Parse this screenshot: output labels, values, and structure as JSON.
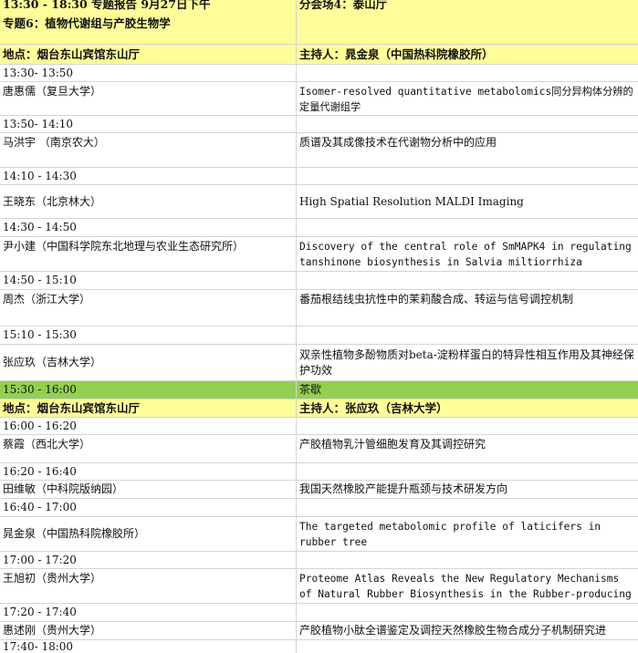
{
  "header": {
    "line1_left": "13:30 - 18:30 专题报告 9月27日下午",
    "line2_left": "专题6：植物代谢组与产胶生物学",
    "right": "分会场4：泰山厅"
  },
  "session1": {
    "location": "地点：烟台东山宾馆东山厅",
    "host": "主持人：晁金泉（中国热科院橡胶所）"
  },
  "break_row": {
    "time": "15:30 - 16:00",
    "label": "茶歇"
  },
  "session2": {
    "location": "地点：烟台东山宾馆东山厅",
    "host": "主持人：张应玖（吉林大学）"
  },
  "talks1": [
    {
      "time": "13:30- 13:50",
      "speaker": "唐惠儒（复旦大学）",
      "title": "Isomer-resolved quantitative metabolomics同分异构体分辨的定量代谢组学"
    },
    {
      "time": "13:50- 14:10",
      "speaker": "马洪宇 （南京农大）",
      "title": "质谱及其成像技术在代谢物分析中的应用"
    },
    {
      "time": "14:10 - 14:30",
      "speaker": "王晓东（北京林大）",
      "title": "High Spatial Resolution MALDI Imaging"
    },
    {
      "time": "14:30 - 14:50",
      "speaker": "尹小建（中国科学院东北地理与农业生态研究所）",
      "title": "Discovery of the central role of SmMAPK4 in regulating tanshinone biosynthesis in Salvia miltiorrhiza"
    },
    {
      "time": "14:50 - 15:10",
      "speaker": "周杰（浙江大学）",
      "title": "番茄根结线虫抗性中的茉莉酸合成、转运与信号调控机制"
    },
    {
      "time": "15:10 - 15:30",
      "speaker": "张应玖（吉林大学）",
      "title": "双亲性植物多酚物质对beta-淀粉样蛋白的特异性相互作用及其神经保护功效"
    }
  ],
  "talks2": [
    {
      "time": "16:00 - 16:20",
      "speaker": "蔡霞（西北大学）",
      "title": "产胶植物乳汁管细胞发育及其调控研究"
    },
    {
      "time": "16:20 - 16:40",
      "speaker": "田维敏（中科院版纳园）",
      "title": "我国天然橡胶产能提升瓶颈与技术研发方向"
    },
    {
      "time": "16:40 - 17:00",
      "speaker": "晁金泉（中国热科院橡胶所）",
      "title": "The targeted metabolomic profile of laticifers in rubber tree"
    },
    {
      "time": "17:00 - 17:20",
      "speaker": "王旭初（贵州大学）",
      "title": "Proteome Atlas Reveals the New Regulatory Mechanisms of Natural Rubber Biosynthesis in the Rubber-producing"
    },
    {
      "time": "17:20 - 17:40",
      "speaker": "惠述刚（贵州大学）",
      "title": "产胶植物小肽全谱鉴定及调控天然橡胶生物合成分子机制研究进"
    },
    {
      "time": "17:40- 18:00",
      "speaker": "",
      "title": ""
    }
  ]
}
